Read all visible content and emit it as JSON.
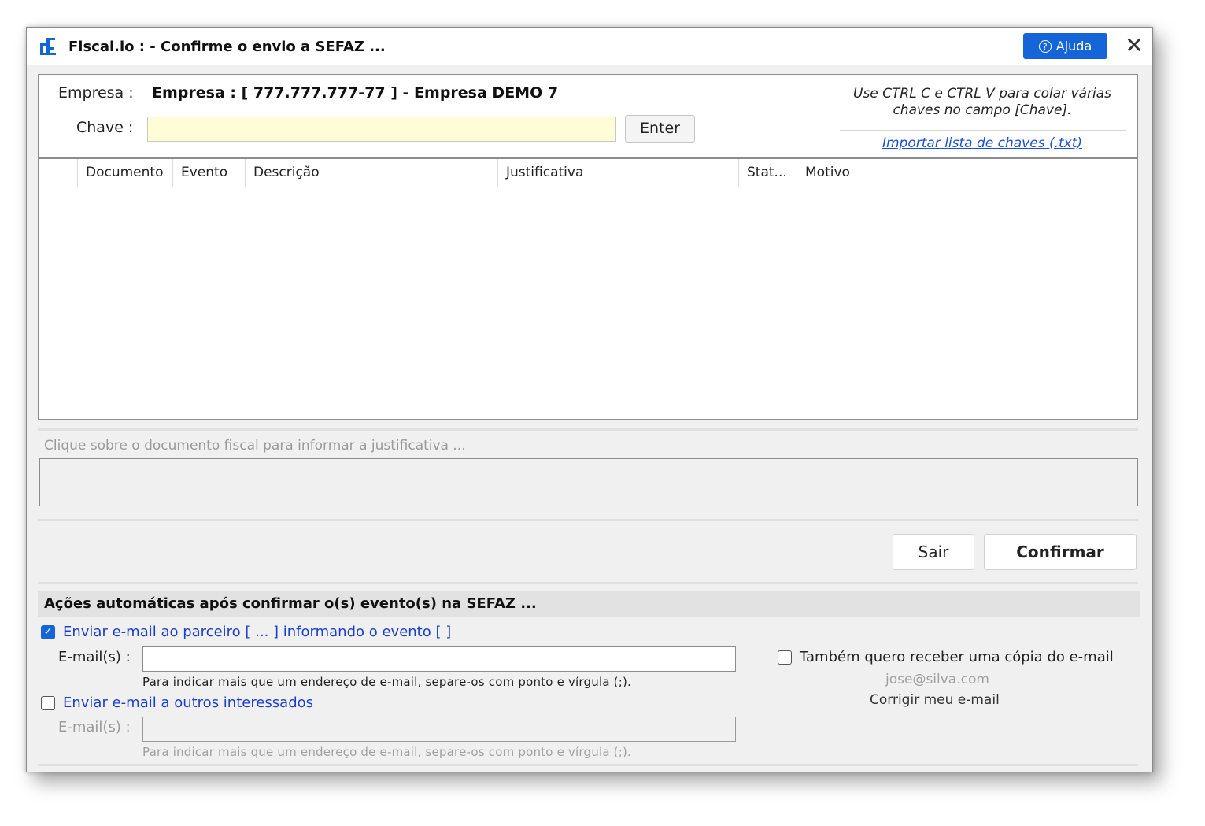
{
  "window": {
    "title": "Fiscal.io :  - Confirme o envio a SEFAZ ...",
    "help_label": "Ajuda",
    "close_glyph": "✕"
  },
  "form": {
    "empresa_label": "Empresa :",
    "empresa_value": "Empresa : [ 777.777.777-77 ] - Empresa DEMO 7",
    "chave_label": "Chave :",
    "chave_value": "",
    "enter_label": "Enter",
    "hint": "Use CTRL C e CTRL V para colar várias chaves no campo [Chave].",
    "import_link": "Importar lista de chaves (.txt)"
  },
  "table": {
    "columns": [
      "Documento",
      "Evento",
      "Descrição",
      "Justificativa",
      "Stat...",
      "Motivo"
    ],
    "rows": []
  },
  "justificativa": {
    "placeholder": "Clique sobre o documento fiscal para informar a justificativa ...",
    "value": ""
  },
  "buttons": {
    "sair": "Sair",
    "confirmar": "Confirmar"
  },
  "acoes": {
    "header": "Ações automáticas após confirmar o(s) evento(s) na SEFAZ ...",
    "parceiro_checkbox_label": "Enviar e-mail ao parceiro [  ... ] informando o evento [  ]",
    "parceiro_checked": true,
    "email_label": "E-mail(s) :",
    "email_value": "",
    "email_note": "Para indicar mais que um endereço de e-mail, separe-os com ponto e vírgula (;).",
    "outros_checkbox_label": "Enviar e-mail a outros interessados",
    "outros_checked": false,
    "outros_email_label": "E-mail(s) :",
    "outros_email_value": "",
    "outros_email_note": "Para indicar mais que um endereço de e-mail, separe-os com ponto e vírgula (;).",
    "copia_checkbox_label": "Também quero receber uma cópia do e-mail",
    "copia_checked": false,
    "user_email": "jose@silva.com",
    "corrigir_link": "Corrigir meu e-mail"
  },
  "colors": {
    "accent": "#1565d8",
    "link": "#1a4fd6",
    "input_highlight": "#fefdd8"
  }
}
